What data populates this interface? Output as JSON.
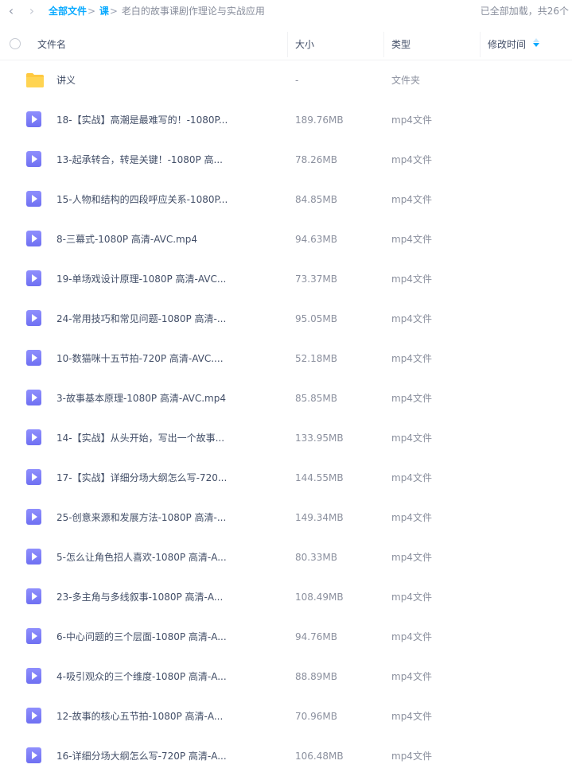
{
  "toolbar": {
    "back_icon": "chevron-left-icon",
    "forward_icon": "chevron-right-icon"
  },
  "breadcrumb": {
    "root": "全部文件",
    "sep1": ">",
    "level1": "课",
    "sep2": ">",
    "current": "老白的故事课剧作理论与实战应用"
  },
  "load_status": "已全部加载，共26个",
  "columns": {
    "name": "文件名",
    "size": "大小",
    "type": "类型",
    "modified": "修改时间"
  },
  "colors": {
    "accent": "#09aaff",
    "video_icon": "#7c7cf8",
    "folder_icon": "#ffc940"
  },
  "files": [
    {
      "name": "讲义",
      "size": "-",
      "type": "文件夹",
      "icon": "folder-icon"
    },
    {
      "name": "18-【实战】高潮是最难写的！-1080P...",
      "size": "189.76MB",
      "type": "mp4文件",
      "icon": "video-file-icon"
    },
    {
      "name": "13-起承转合，转是关键！-1080P 高...",
      "size": "78.26MB",
      "type": "mp4文件",
      "icon": "video-file-icon"
    },
    {
      "name": "15-人物和结构的四段呼应关系-1080P...",
      "size": "84.85MB",
      "type": "mp4文件",
      "icon": "video-file-icon"
    },
    {
      "name": "8-三幕式-1080P 高清-AVC.mp4",
      "size": "94.63MB",
      "type": "mp4文件",
      "icon": "video-file-icon"
    },
    {
      "name": "19-单场戏设计原理-1080P 高清-AVC...",
      "size": "73.37MB",
      "type": "mp4文件",
      "icon": "video-file-icon"
    },
    {
      "name": "24-常用技巧和常见问题-1080P 高清-...",
      "size": "95.05MB",
      "type": "mp4文件",
      "icon": "video-file-icon"
    },
    {
      "name": "10-数猫咪十五节拍-720P 高清-AVC....",
      "size": "52.18MB",
      "type": "mp4文件",
      "icon": "video-file-icon"
    },
    {
      "name": "3-故事基本原理-1080P 高清-AVC.mp4",
      "size": "85.85MB",
      "type": "mp4文件",
      "icon": "video-file-icon"
    },
    {
      "name": "14-【实战】从头开始，写出一个故事...",
      "size": "133.95MB",
      "type": "mp4文件",
      "icon": "video-file-icon"
    },
    {
      "name": "17-【实战】详细分场大纲怎么写-720...",
      "size": "144.55MB",
      "type": "mp4文件",
      "icon": "video-file-icon"
    },
    {
      "name": "25-创意来源和发展方法-1080P 高清-...",
      "size": "149.34MB",
      "type": "mp4文件",
      "icon": "video-file-icon"
    },
    {
      "name": "5-怎么让角色招人喜欢-1080P 高清-A...",
      "size": "80.33MB",
      "type": "mp4文件",
      "icon": "video-file-icon"
    },
    {
      "name": "23-多主角与多线叙事-1080P 高清-A...",
      "size": "108.49MB",
      "type": "mp4文件",
      "icon": "video-file-icon"
    },
    {
      "name": "6-中心问题的三个层面-1080P 高清-A...",
      "size": "94.76MB",
      "type": "mp4文件",
      "icon": "video-file-icon"
    },
    {
      "name": "4-吸引观众的三个维度-1080P 高清-A...",
      "size": "88.89MB",
      "type": "mp4文件",
      "icon": "video-file-icon"
    },
    {
      "name": "12-故事的核心五节拍-1080P 高清-A...",
      "size": "70.96MB",
      "type": "mp4文件",
      "icon": "video-file-icon"
    },
    {
      "name": "16-详细分场大纲怎么写-720P 高清-A...",
      "size": "106.48MB",
      "type": "mp4文件",
      "icon": "video-file-icon"
    }
  ]
}
